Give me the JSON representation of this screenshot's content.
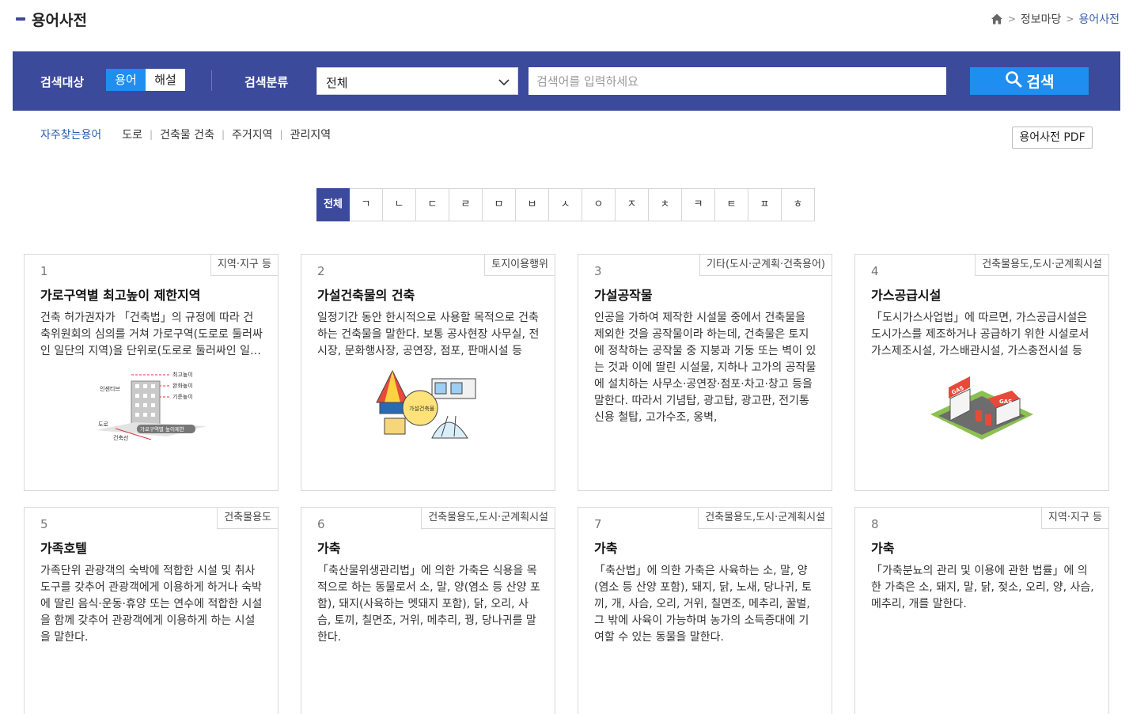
{
  "header": {
    "title": "용어사전",
    "breadcrumb": [
      "정보마당",
      "용어사전"
    ]
  },
  "search": {
    "target_label": "검색대상",
    "target_options": [
      "용어",
      "해설"
    ],
    "target_selected": "용어",
    "class_label": "검색분류",
    "class_selected": "전체",
    "placeholder": "검색어를 입력하세요",
    "button_label": "검색"
  },
  "frequent": {
    "label": "자주찾는용어",
    "items": [
      "도로",
      "건축물 건축",
      "주거지역",
      "관리지역"
    ]
  },
  "pdf_button": "용어사전 PDF",
  "consonants": [
    "전체",
    "ㄱ",
    "ㄴ",
    "ㄷ",
    "ㄹ",
    "ㅁ",
    "ㅂ",
    "ㅅ",
    "ㅇ",
    "ㅈ",
    "ㅊ",
    "ㅋ",
    "ㅌ",
    "ㅍ",
    "ㅎ"
  ],
  "consonant_active": "전체",
  "cards": [
    {
      "num": "1",
      "category": "지역·지구 등",
      "term": "가로구역별 최고높이 제한지역",
      "desc": "건축 허가권자가 「건축법」의 규정에 따라 건축위원회의 심의를 거쳐 가로구역(도로로 둘러싸인 일단의 지역)을 단위로(도로로 둘러싸인 일단의 지역)",
      "illus": {
        "labels": [
          "최고높이",
          "완화높이",
          "기준높이",
          "인센티브",
          "도로",
          "건축선",
          "가로구역별 높이제한"
        ]
      }
    },
    {
      "num": "2",
      "category": "토지이용행위",
      "term": "가설건축물의 건축",
      "desc": "일정기간 동안 한시적으로 사용할 목적으로 건축하는 건축물을 말한다. 보통 공사현장 사무실, 전시장, 문화행사장, 공연장, 점포, 판매시설 등",
      "illus": {
        "labels": [
          "가설건축물"
        ]
      }
    },
    {
      "num": "3",
      "category": "기타(도시·군계획·건축용어)",
      "term": "가설공작물",
      "desc": "인공을 가하여 제작한 시설물 중에서 건축물을 제외한 것을 공작물이라 하는데, 건축물은 토지에 정착하는 공작물 중 지붕과 기둥 또는 벽이 있는 것과 이에 딸린 시설물, 지하나 고가의 공작물에 설치하는 사무소·공연장·점포·차고·창고 등을 말한다. 따라서 기념탑, 광고탑, 광고판, 전기통신용 철탑, 고가수조, 옹벽,"
    },
    {
      "num": "4",
      "category": "건축물용도,도시·군계획시설",
      "term": "가스공급시설",
      "desc": "「도시가스사업법」에 따르면, 가스공급시설은 도시가스를 제조하거나 공급하기 위한 시설로서 가스제조시설, 가스배관시설, 가스충전시설 등",
      "illus": {
        "labels": [
          "GAS",
          "GAS"
        ]
      }
    },
    {
      "num": "5",
      "category": "건축물용도",
      "term": "가족호텔",
      "desc": "가족단위 관광객의 숙박에 적합한 시설 및 취사도구를 갖추어 관광객에게 이용하게 하거나 숙박에 딸린 음식·운동·휴양 또는 연수에 적합한 시설을 함께 갖추어 관광객에게 이용하게 하는 시설을 말한다."
    },
    {
      "num": "6",
      "category": "건축물용도,도시·군계획시설",
      "term": "가축",
      "desc": "「축산물위생관리법」에 의한 가축은 식용을 목적으로 하는 동물로서 소, 말, 양(염소 등 산양 포함), 돼지(사육하는 멧돼지 포함), 닭, 오리, 사슴, 토끼, 칠면조, 거위, 메추리, 꿩, 당나귀를 말한다."
    },
    {
      "num": "7",
      "category": "건축물용도,도시·군계획시설",
      "term": "가축",
      "desc": "「축산법」에 의한 가축은 사육하는 소, 말, 양(염소 등 산양 포함), 돼지, 닭, 노새, 당나귀, 토끼, 개, 사슴, 오리, 거위, 칠면조, 메추리, 꿀벌, 그 밖에 사육이 가능하며 농가의 소득증대에 기여할 수 있는 동물을 말한다."
    },
    {
      "num": "8",
      "category": "지역·지구 등",
      "term": "가축",
      "desc": "「가축분뇨의 관리 및 이용에 관한 법률」에 의한 가축은 소, 돼지, 말, 닭, 젖소, 오리, 양, 사슴, 메추리, 개를 말한다."
    }
  ],
  "colors": {
    "panel": "#3b4a9b",
    "accent": "#1e8ef0",
    "link": "#2a5db0"
  }
}
